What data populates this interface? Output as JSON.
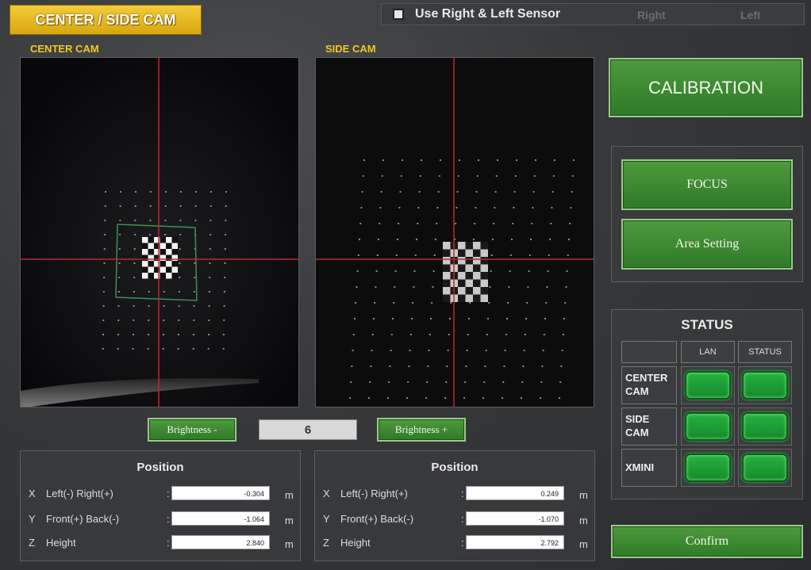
{
  "header": {
    "title": "CENTER / SIDE CAM",
    "use_sensor_label": "Use Right & Left Sensor",
    "right_label": "Right",
    "left_label": "Left"
  },
  "center_cam": {
    "label": "CENTER CAM"
  },
  "side_cam": {
    "label": "SIDE CAM"
  },
  "buttons": {
    "calibration": "CALIBRATION",
    "focus": "FOCUS",
    "area_setting": "Area Setting",
    "confirm": "Confirm",
    "brightness_down": "Brightness -",
    "brightness_up": "Brightness +"
  },
  "brightness": {
    "value": "6"
  },
  "position_center": {
    "title": "Position",
    "rows": [
      {
        "axis": "X",
        "label": "Left(-) Right(+)",
        "value": "-0.304",
        "unit": "m"
      },
      {
        "axis": "Y",
        "label": "Front(+) Back(-)",
        "value": "-1.064",
        "unit": "m"
      },
      {
        "axis": "Z",
        "label": "Height",
        "value": "2.840",
        "unit": "m"
      }
    ]
  },
  "position_side": {
    "title": "Position",
    "rows": [
      {
        "axis": "X",
        "label": "Left(-) Right(+)",
        "value": "0.249",
        "unit": "m"
      },
      {
        "axis": "Y",
        "label": "Front(+) Back(-)",
        "value": "-1.070",
        "unit": "m"
      },
      {
        "axis": "Z",
        "label": "Height",
        "value": "2.792",
        "unit": "m"
      }
    ]
  },
  "status": {
    "title": "STATUS",
    "col_lan": "LAN",
    "col_status": "STATUS",
    "rows": [
      {
        "label_1": "CENTER",
        "label_2": "CAM",
        "lan": "on",
        "status": "on"
      },
      {
        "label_1": "SIDE",
        "label_2": "CAM",
        "lan": "on",
        "status": "on"
      },
      {
        "label_1": "XMINI",
        "label_2": "",
        "lan": "on",
        "status": "on"
      }
    ]
  },
  "colors": {
    "accent_yellow": "#f2c823",
    "button_green": "#3e8a31",
    "led_green": "#27b23f",
    "crosshair_red": "#c0272d"
  }
}
